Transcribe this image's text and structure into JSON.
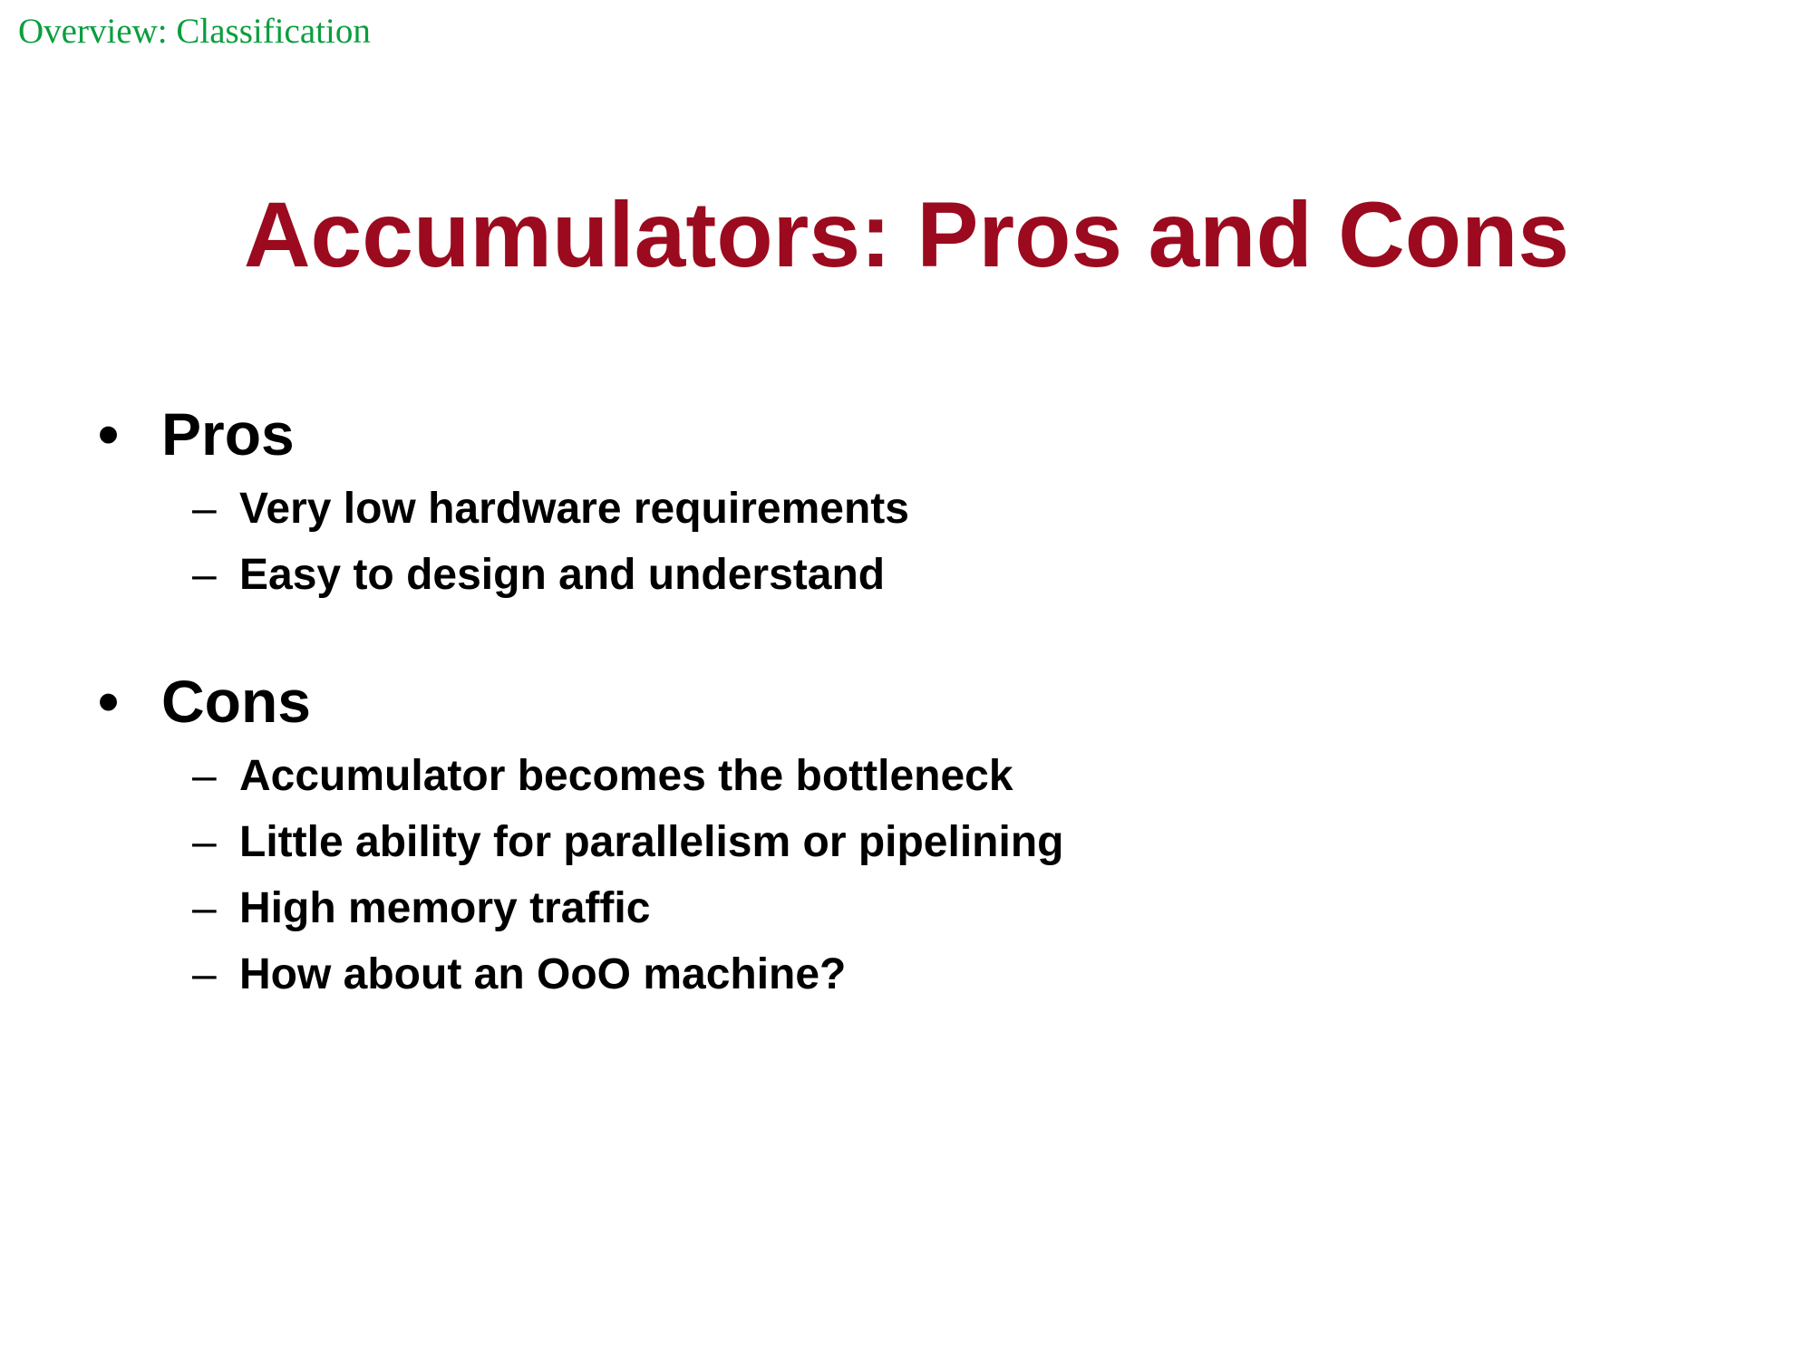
{
  "header": {
    "section": "Overview: Classification"
  },
  "slide": {
    "title": "Accumulators: Pros and Cons",
    "bullets": [
      {
        "label": "Pros",
        "marker": "•",
        "items": [
          "Very low hardware requirements",
          "Easy to design and understand"
        ]
      },
      {
        "label": "Cons",
        "marker": "•",
        "items": [
          "Accumulator becomes the bottleneck",
          "Little ability for parallelism or pipelining",
          "High memory traffic",
          "How about an OoO machine?"
        ]
      }
    ],
    "sub_marker": "–"
  },
  "colors": {
    "header": "#0a9e3e",
    "title": "#9b0a1e",
    "text": "#000000",
    "background": "#ffffff"
  }
}
